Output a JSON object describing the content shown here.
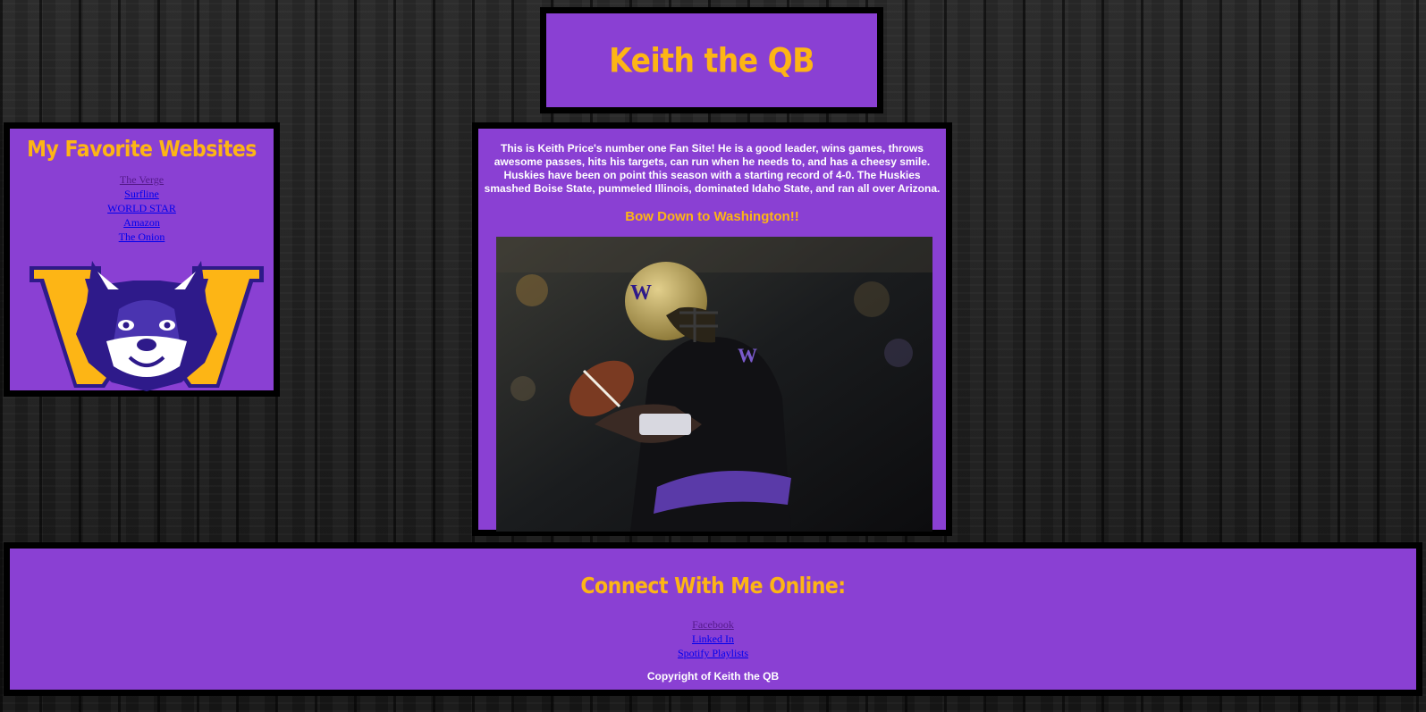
{
  "header": {
    "title": "Keith the QB"
  },
  "sidebar": {
    "heading": "My Favorite Websites",
    "links": [
      {
        "label": "The Verge",
        "visited": true
      },
      {
        "label": "Surfline",
        "visited": false
      },
      {
        "label": "WORLD STAR",
        "visited": false
      },
      {
        "label": "Amazon",
        "visited": false
      },
      {
        "label": "The Onion",
        "visited": false
      }
    ],
    "logo_icon": "husky-w-logo"
  },
  "main": {
    "intro": "This is Keith Price's number one Fan Site! He is a good leader, wins games, throws awesome passes, hits his targets, can run when he needs to, and has a cheesy smile. Huskies have been on point this season with a starting record of 4-0. The Huskies smashed Boise State, pummeled Illinois, dominated Idaho State, and ran all over Arizona.",
    "tagline": "Bow Down to Washington!!",
    "photo_icon": "quarterback-photo"
  },
  "footer": {
    "heading": "Connect With Me Online:",
    "links": [
      {
        "label": "Facebook",
        "visited": true
      },
      {
        "label": "Linked In",
        "visited": false
      },
      {
        "label": "Spotify Playlists",
        "visited": false
      }
    ],
    "copyright": "Copyright of Keith the QB"
  },
  "colors": {
    "panel": "#8a40d3",
    "gold": "#fdb515",
    "border": "#000000",
    "husky_purple": "#2e1a8a"
  }
}
